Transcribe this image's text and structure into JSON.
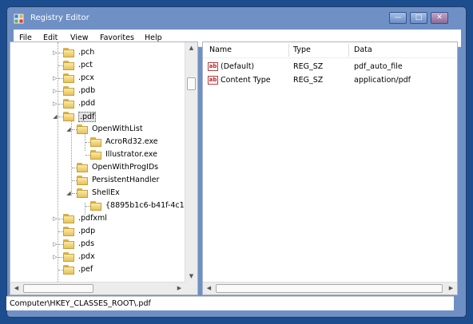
{
  "window": {
    "title": "Registry Editor",
    "minimize_glyph": "—",
    "maximize_glyph": "□",
    "close_glyph": "✕"
  },
  "menu": [
    "File",
    "Edit",
    "View",
    "Favorites",
    "Help"
  ],
  "tree": {
    "items": [
      {
        "label": ".pch",
        "expander": "collapsed"
      },
      {
        "label": ".pct",
        "expander": "none"
      },
      {
        "label": ".pcx",
        "expander": "collapsed"
      },
      {
        "label": ".pdb",
        "expander": "collapsed"
      },
      {
        "label": ".pdd",
        "expander": "collapsed"
      },
      {
        "label": ".pdf",
        "expander": "expanded",
        "selected": true
      },
      {
        "label": "OpenWithList",
        "expander": "expanded"
      },
      {
        "label": "AcroRd32.exe",
        "expander": "none"
      },
      {
        "label": "Illustrator.exe",
        "expander": "none"
      },
      {
        "label": "OpenWithProgIDs",
        "expander": "none"
      },
      {
        "label": "PersistentHandler",
        "expander": "none"
      },
      {
        "label": "ShellEx",
        "expander": "expanded"
      },
      {
        "label": "{8895b1c6-b41f-4c1",
        "expander": "none"
      },
      {
        "label": ".pdfxml",
        "expander": "collapsed"
      },
      {
        "label": ".pdp",
        "expander": "none"
      },
      {
        "label": ".pds",
        "expander": "collapsed"
      },
      {
        "label": ".pdx",
        "expander": "collapsed"
      },
      {
        "label": ".pef",
        "expander": "none"
      }
    ]
  },
  "list": {
    "columns": [
      "Name",
      "Type",
      "Data"
    ],
    "rows": [
      {
        "icon": "ab",
        "name": "(Default)",
        "type": "REG_SZ",
        "data": "pdf_auto_file"
      },
      {
        "icon": "ab",
        "name": "Content Type",
        "type": "REG_SZ",
        "data": "application/pdf"
      }
    ]
  },
  "scroll_glyphs": {
    "up": "▲",
    "down": "▼",
    "left": "◀",
    "right": "▶"
  },
  "status": "Computer\\HKEY_CLASSES_ROOT\\.pdf",
  "icons": {
    "app": "registry-editor-icon",
    "folder": "folder-icon",
    "value": "string-value-icon",
    "expand": "triangle-right-icon",
    "collapse": "triangle-down-icon"
  },
  "colors": {
    "desktop": "#1c4e8f",
    "frame": "#6f90c4",
    "selection": "#e4e4e4",
    "value_icon": "#c62020"
  }
}
